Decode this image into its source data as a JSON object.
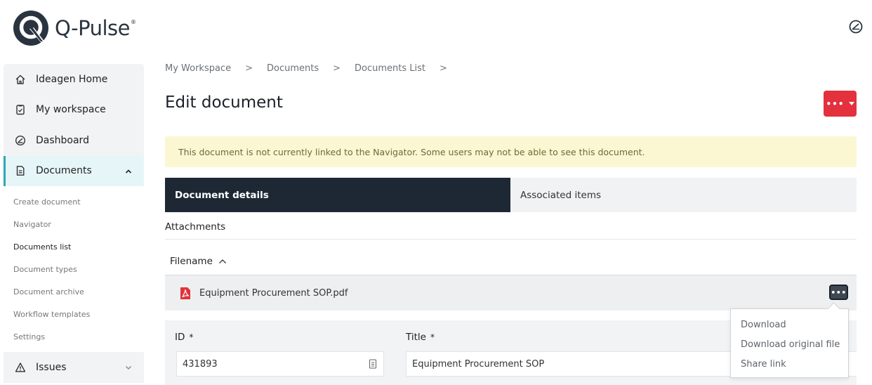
{
  "app": {
    "name": "Q-Pulse",
    "reg_mark": "®"
  },
  "header": {
    "right_icon": "dashboard-gauge-icon"
  },
  "sidebar": {
    "items": [
      {
        "label": "Ideagen Home",
        "icon": "home-icon"
      },
      {
        "label": "My workspace",
        "icon": "clipboard-icon"
      },
      {
        "label": "Dashboard",
        "icon": "gauge-icon"
      },
      {
        "label": "Documents",
        "icon": "document-icon",
        "active": true
      }
    ],
    "sub_items": [
      {
        "label": "Create document"
      },
      {
        "label": "Navigator"
      },
      {
        "label": "Documents list",
        "current": true
      },
      {
        "label": "Document types"
      },
      {
        "label": "Document archive"
      },
      {
        "label": "Workflow templates"
      },
      {
        "label": "Settings"
      }
    ],
    "issues": {
      "label": "Issues",
      "icon": "warning-icon"
    }
  },
  "breadcrumb": [
    "My Workspace",
    "Documents",
    "Documents List"
  ],
  "breadcrumb_separator": ">",
  "page": {
    "title": "Edit document",
    "menu_button": "•••"
  },
  "alert": {
    "text": "This document is not currently linked to the Navigator. Some users may not be able to see this document.",
    "bg_color": "#fbf7d3"
  },
  "tabs": [
    {
      "label": "Document details",
      "active": true
    },
    {
      "label": "Associated items",
      "active": false
    }
  ],
  "attachments": {
    "section_label": "Attachments",
    "column_header": "Filename",
    "files": [
      {
        "name": "Equipment Procurement SOP.pdf",
        "icon": "pdf-icon"
      }
    ],
    "row_menu_label": "•••",
    "row_menu_options": [
      "Download",
      "Download original file",
      "Share link"
    ]
  },
  "form": {
    "id_label": "ID",
    "id_value": "431893",
    "title_label": "Title",
    "title_value": "Equipment Procurement SOP",
    "required_mark": "*"
  },
  "colors": {
    "accent_teal": "#2fa6b4",
    "menu_red": "#e3313d",
    "dark_tab": "#1e2835"
  }
}
